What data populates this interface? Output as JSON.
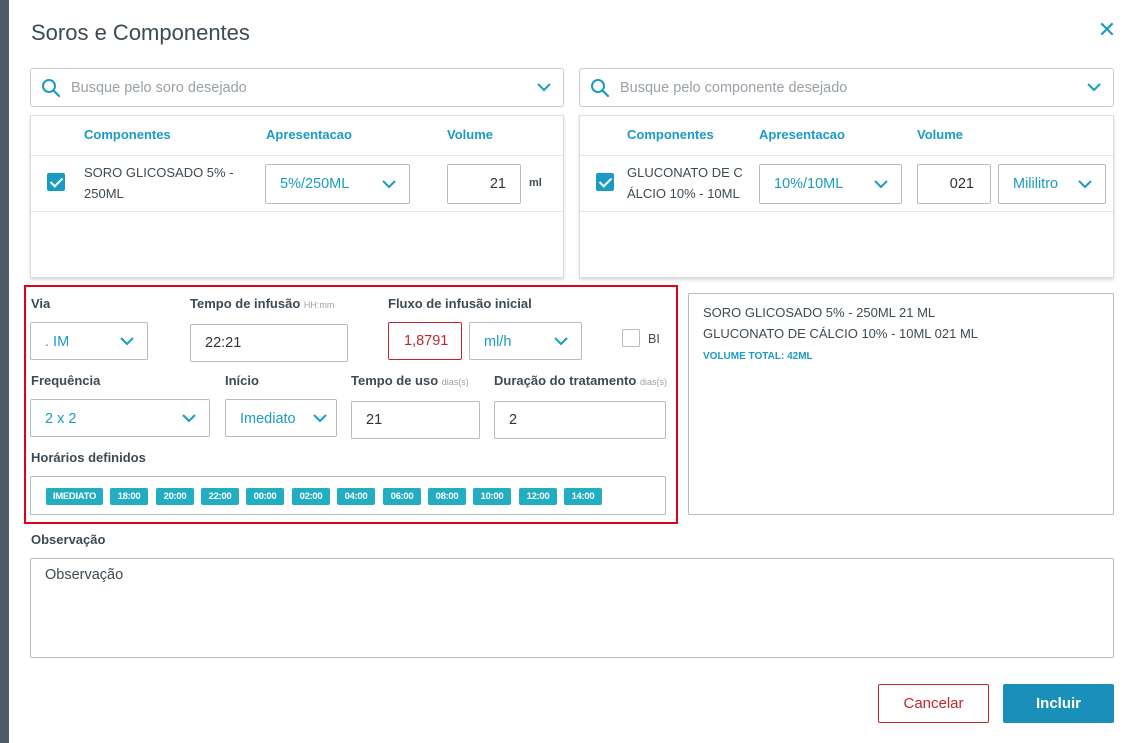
{
  "dialog": {
    "title": "Soros e Componentes",
    "close_icon": "close-icon"
  },
  "search_soro": {
    "placeholder": "Busque pelo soro desejado"
  },
  "search_comp": {
    "placeholder": "Busque pelo componente desejado"
  },
  "soro_table": {
    "headers": [
      "Componentes",
      "Apresentacao",
      "Volume"
    ],
    "rows": [
      {
        "checked": true,
        "name_line1": "SORO GLICOSADO 5% -",
        "name_line2": "250ML",
        "presentation": "5%/250ML",
        "volume": "21",
        "unit": "ml"
      }
    ]
  },
  "comp_table": {
    "headers": [
      "Componentes",
      "Apresentacao",
      "Volume"
    ],
    "rows": [
      {
        "checked": true,
        "name_line1": "GLUCONATO DE C",
        "name_line2": "ÁLCIO 10% - 10ML",
        "presentation": "10%/10ML",
        "volume": "021",
        "unit": "Mililitro"
      }
    ]
  },
  "form": {
    "via_label": "Via",
    "via_value": ". IM",
    "tempo_infusao_label": "Tempo de infusão",
    "tempo_infusao_hint": "HH:mm",
    "tempo_infusao_value": "22:21",
    "fluxo_label": "Fluxo de infusão inicial",
    "fluxo_value": "1,8791",
    "fluxo_unit": "ml/h",
    "bi_label": "BI",
    "bi_checked": false,
    "frequencia_label": "Frequência",
    "frequencia_value": "2 x 2",
    "inicio_label": "Início",
    "inicio_value": "Imediato",
    "tempo_uso_label": "Tempo de uso",
    "tempo_uso_hint": "dias(s)",
    "tempo_uso_value": "21",
    "duracao_label": "Duração do tratamento",
    "duracao_hint": "dias(s)",
    "duracao_value": "2",
    "horarios_label": "Horários definidos",
    "horarios": [
      "IMEDIATO",
      "18:00",
      "20:00",
      "22:00",
      "00:00",
      "02:00",
      "04:00",
      "06:00",
      "08:00",
      "10:00",
      "12:00",
      "14:00"
    ]
  },
  "summary": {
    "lines": [
      "SORO GLICOSADO 5% - 250ML 21 ML",
      "GLUCONATO DE CÁLCIO 10% - 10ML 021 ML"
    ],
    "total": "VOLUME TOTAL: 42ML"
  },
  "observacao": {
    "label": "Observação",
    "placeholder": "Observação"
  },
  "buttons": {
    "cancel": "Cancelar",
    "ok": "Incluir"
  },
  "colors": {
    "accent": "#1a9bc4",
    "chip": "#22adc1",
    "danger": "#c0262d",
    "highlight_border": "#e0001b",
    "fluxo_text": "#c0262d"
  }
}
